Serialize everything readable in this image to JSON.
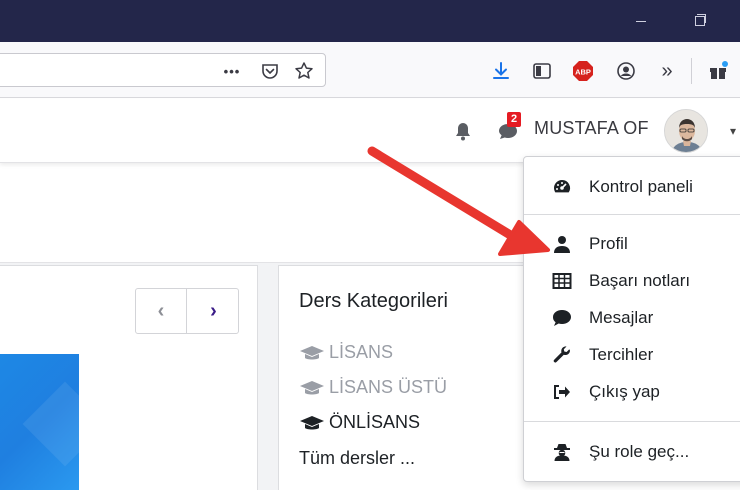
{
  "browser": {
    "url_more": "•••",
    "downloads_badge": true
  },
  "navbar": {
    "notification_count": "2",
    "username": "MUSTAFA OF"
  },
  "course_nav": {
    "prev": "‹",
    "next": "›"
  },
  "categories": {
    "title": "Ders Kategorileri",
    "items": [
      {
        "label": "LİSANS",
        "style": "muted"
      },
      {
        "label": "LİSANS ÜSTÜ",
        "style": "muted"
      },
      {
        "label": "ÖNLİSANS",
        "style": "dark"
      },
      {
        "label": "Tüm dersler ...",
        "style": "link"
      }
    ]
  },
  "user_menu": {
    "items": [
      {
        "label": "Kontrol paneli",
        "icon": "dashboard-icon"
      },
      {
        "label": "Profil",
        "icon": "user-icon"
      },
      {
        "label": "Başarı notları",
        "icon": "grades-table-icon"
      },
      {
        "label": "Mesajlar",
        "icon": "speech-bubble-icon"
      },
      {
        "label": "Tercihler",
        "icon": "wrench-icon"
      },
      {
        "label": "Çıkış yap",
        "icon": "sign-out-icon"
      },
      {
        "label": "Şu role geç...",
        "icon": "user-secret-icon"
      }
    ]
  },
  "colors": {
    "titlebar": "#23264a",
    "arrow": "#e8362f",
    "badge": "#e51b23",
    "accent_next": "#3a1b87",
    "course_image": "#1e88e5"
  }
}
